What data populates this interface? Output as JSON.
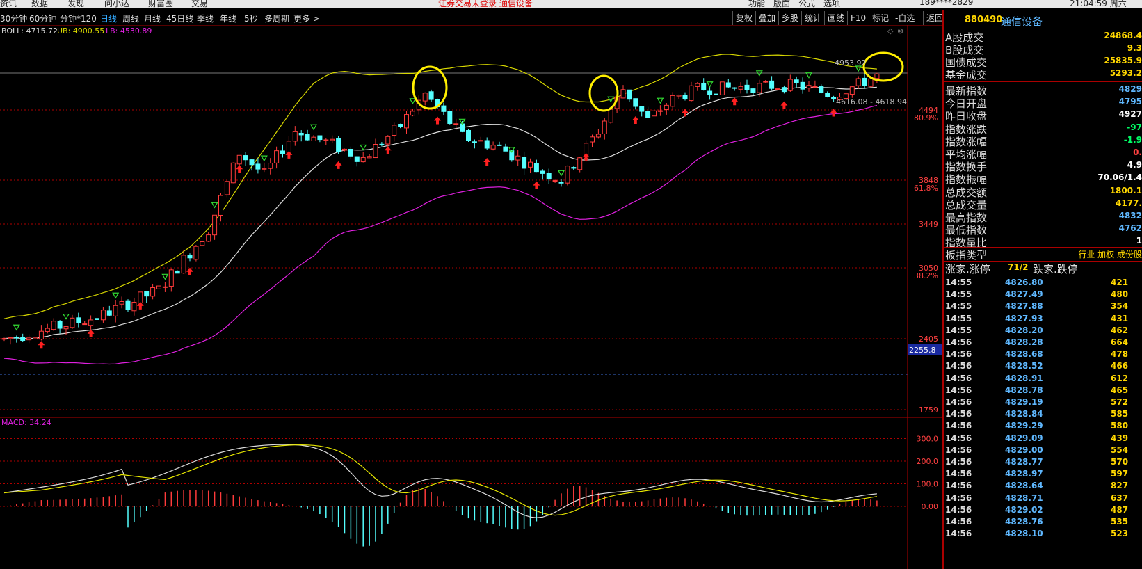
{
  "top_menu": {
    "left": [
      "资讯",
      "数据",
      "发现",
      "问小达",
      "财富圈",
      "交易"
    ],
    "status": "证券交易未登录  通信设备",
    "right": [
      "功能",
      "版面",
      "公式",
      "选项"
    ],
    "account": "189****2829",
    "time": "21:04:59 周六"
  },
  "periods": [
    "30分钟",
    "60分钟",
    "分钟*120",
    "日线",
    "周线",
    "月线",
    "45日线",
    "季线",
    "年线",
    "5秒",
    "多周期",
    "更多 >"
  ],
  "active_period": "日线",
  "toolbar": [
    "复权",
    "叠加",
    "多股",
    "统计",
    "画线",
    "F10",
    "标记",
    "-自选",
    "返回"
  ],
  "boll": {
    "label": "BOLL: 4715.72",
    "ub": "UB: 4900.55",
    "lb": "LB: 4530.89"
  },
  "price_axis": [
    {
      "v": 4494,
      "t": "4494",
      "pct": "80.9%"
    },
    {
      "v": 3848,
      "t": "3848",
      "pct": "61.8%"
    },
    {
      "v": 3449,
      "t": "3449",
      "pct": ""
    },
    {
      "v": 3050,
      "t": "3050",
      "pct": "38.2%"
    },
    {
      "v": 2405,
      "t": "2405",
      "pct": ""
    },
    {
      "v": 1759,
      "t": "1759",
      "pct": ""
    }
  ],
  "crosshair_price": "2255.8",
  "annotation_high": "4953.92",
  "annotation_range": "4616.08 - 4618.94",
  "macd": {
    "label": "MACD: 34.24",
    "axis": [
      "300.0",
      "200.0",
      "100.0",
      "0.00"
    ]
  },
  "panel": {
    "code": "880490",
    "name": "通信设备",
    "top_rows": [
      {
        "l": "A股成交",
        "r": "24868.4"
      },
      {
        "l": "B股成交",
        "r": "9.3"
      },
      {
        "l": "国债成交",
        "r": "25835.9"
      },
      {
        "l": "基金成交",
        "r": "5293.2"
      }
    ],
    "rows": [
      {
        "l": "最新指数",
        "r": "4829"
      },
      {
        "l": "今日开盘",
        "r": "4795"
      },
      {
        "l": "昨日收盘",
        "r": "4927"
      },
      {
        "l": "指数涨跌",
        "r": "-97"
      },
      {
        "l": "指数涨幅",
        "r": "-1.9"
      },
      {
        "l": "平均涨幅",
        "r": "0."
      },
      {
        "l": "指数换手",
        "r": "4.9"
      },
      {
        "l": "指数振幅",
        "r": "70.06/1.4"
      },
      {
        "l": "总成交额",
        "r": "1800.1"
      },
      {
        "l": "总成交量",
        "r": "4177."
      },
      {
        "l": "最高指数",
        "r": "4832"
      },
      {
        "l": "最低指数",
        "r": "4762"
      },
      {
        "l": "指数量比",
        "r": "1"
      }
    ],
    "type_row": {
      "l": "板指类型",
      "r": "行业 加权 成份股"
    },
    "updown_row": {
      "l": "涨家.涨停",
      "m": "71/2",
      "r": "跌家.跌停"
    },
    "ticks": [
      {
        "t": "14:55",
        "p": "4826.80",
        "v": "421"
      },
      {
        "t": "14:55",
        "p": "4827.49",
        "v": "480"
      },
      {
        "t": "14:55",
        "p": "4827.88",
        "v": "354"
      },
      {
        "t": "14:55",
        "p": "4827.93",
        "v": "431"
      },
      {
        "t": "14:55",
        "p": "4828.20",
        "v": "462"
      },
      {
        "t": "14:56",
        "p": "4828.28",
        "v": "664"
      },
      {
        "t": "14:56",
        "p": "4828.68",
        "v": "478"
      },
      {
        "t": "14:56",
        "p": "4828.52",
        "v": "466"
      },
      {
        "t": "14:56",
        "p": "4828.91",
        "v": "612"
      },
      {
        "t": "14:56",
        "p": "4828.78",
        "v": "465"
      },
      {
        "t": "14:56",
        "p": "4829.19",
        "v": "572"
      },
      {
        "t": "14:56",
        "p": "4828.84",
        "v": "585"
      },
      {
        "t": "14:56",
        "p": "4829.29",
        "v": "580"
      },
      {
        "t": "14:56",
        "p": "4829.09",
        "v": "439"
      },
      {
        "t": "14:56",
        "p": "4829.00",
        "v": "554"
      },
      {
        "t": "14:56",
        "p": "4828.77",
        "v": "570"
      },
      {
        "t": "14:56",
        "p": "4828.97",
        "v": "597"
      },
      {
        "t": "14:56",
        "p": "4828.64",
        "v": "827"
      },
      {
        "t": "14:56",
        "p": "4828.71",
        "v": "637"
      },
      {
        "t": "14:56",
        "p": "4829.02",
        "v": "487"
      },
      {
        "t": "14:56",
        "p": "4828.76",
        "v": "535"
      },
      {
        "t": "14:56",
        "p": "4828.10",
        "v": "523"
      }
    ]
  },
  "colors": {
    "up": "#ff3b3b",
    "down": "#54ffff",
    "ub": "#d8d800",
    "mid": "#dddddd",
    "lb": "#e020e0",
    "grid": "#b00000",
    "axis_text": "#ff4040",
    "macd_dif": "#dddddd",
    "macd_dea": "#e6e600"
  }
}
